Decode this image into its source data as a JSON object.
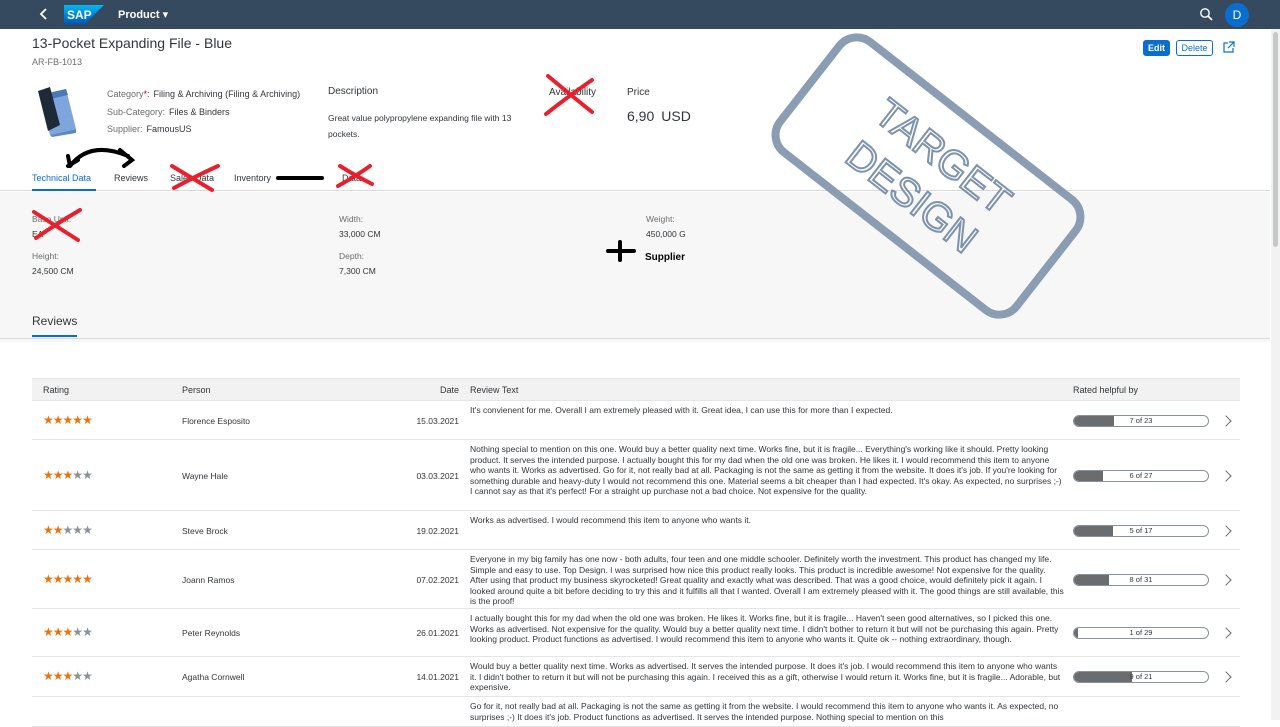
{
  "shell": {
    "app_title": "Product ▾",
    "avatar_initial": "D",
    "logo_text": "SAP"
  },
  "header": {
    "title": "13-Pocket Expanding File - Blue",
    "product_id": "AR-FB-1013",
    "edit_label": "Edit",
    "delete_label": "Delete",
    "category_label": "Category",
    "category_value": "Filing & Archiving (Filing & Archiving)",
    "subcategory_label": "Sub-Category:",
    "subcategory_value": "Files & Binders",
    "supplier_label": "Supplier:",
    "supplier_value": "FamousUS",
    "description_label": "Description",
    "description_text": "Great value polypropylene expanding file with 13 pockets.",
    "availability_label": "Availability",
    "price_label": "Price",
    "price_value": "6,90",
    "price_currency": "USD"
  },
  "tabs": [
    {
      "label": "Technical Data",
      "active": true
    },
    {
      "label": "Reviews"
    },
    {
      "label": "Sales Data"
    },
    {
      "label": "Inventory"
    },
    {
      "label": "Data"
    }
  ],
  "technical_data": {
    "base_unit_label": "Base Unit:",
    "base_unit_value": "EA",
    "width_label": "Width:",
    "width_value": "33,000 CM",
    "weight_label": "Weight:",
    "weight_value": "450,000 G",
    "height_label": "Height:",
    "height_value": "24,500 CM",
    "depth_label": "Depth:",
    "depth_value": "7,300 CM"
  },
  "annotations": {
    "plus_supplier": "Supplier",
    "stamp_line1": "TARGET",
    "stamp_line2": "DESIGN"
  },
  "reviews": {
    "section_title": "Reviews",
    "columns": [
      "Rating",
      "Person",
      "Date",
      "Review Text",
      "Rated helpful by"
    ],
    "rows": [
      {
        "rating": 5,
        "person": "Florence Esposito",
        "date": "15.03.2021",
        "text": "It's convienent for me. Overall I am extremely pleased with it. Great idea, I can use this for more than I expected.",
        "helpful": "7 of 23",
        "helpful_fraction": 0.3
      },
      {
        "rating": 3,
        "person": "Wayne Hale",
        "date": "03.03.2021",
        "text": "Nothing special to mention on this one. Would buy a better quality next time. Works fine, but it is fragile... Everything's working like it should. Pretty looking product. It serves the intended purpose. I actually bought this for my dad when the old one was broken. He likes it. I would recommend this item to anyone who wants it. Works as advertised. Go for it, not really bad at all. Packaging is not the same as getting it from the website. It does it's job. If you're looking for something durable and heavy-duty I would not recommend this one. Material seems a bit cheaper than I had expected. It's okay. As expected, no surprises ;-) I cannot say as that it's perfect! For a straight up purchase not a bad choice. Not expensive for the quality.",
        "helpful": "6 of 27",
        "helpful_fraction": 0.22
      },
      {
        "rating": 2,
        "person": "Steve Brock",
        "date": "19.02.2021",
        "text": "Works as advertised. I would recommend this item to anyone who wants it.",
        "helpful": "5 of 17",
        "helpful_fraction": 0.29
      },
      {
        "rating": 5,
        "person": "Joann Ramos",
        "date": "07.02.2021",
        "text": "Everyone in my big family has one now - both adults, four teen and one middle schooler. Definitely worth the investment. This product has changed my life. Simple and easy to use. Top Design. I was surprised how nice this product really looks. This product is incredible awesome! Not expensive for the quality. After using that product my business skyrocketed! Great quality and exactly what was described. That was a good choice, would definitely pick it again. I looked around quite a bit before deciding to try this and it fulfills all that I wanted. Overall I am extremely pleased with it. The good things are still available, this is the proof!",
        "helpful": "8 of 31",
        "helpful_fraction": 0.26
      },
      {
        "rating": 3,
        "person": "Peter Reynolds",
        "date": "26.01.2021",
        "text": "I actually bought this for my dad when the old one was broken. He likes it. Works fine, but it is fragile... Haven't seen good alternatives, so I picked this one. Works as advertised. Not expensive for the quality. Would buy a better quality next time. I didn't bother to return it but will not be purchasing this again. Pretty looking product. Product functions as advertised. I would recommend this item to anyone who wants it. Quite ok -- nothing extraordinary, though.",
        "helpful": "1 of 29",
        "helpful_fraction": 0.03
      },
      {
        "rating": 3,
        "person": "Agatha Cornwell",
        "date": "14.01.2021",
        "text": "Would buy a better quality next time. Works as advertised. It serves the intended purpose. It does it's job. I would recommend this item to anyone who wants it. I didn't bother to return it but will not be purchasing this again. I received this as a gift, otherwise I would return it. Works fine, but it is fragile... Adorable, but expensive.",
        "helpful": "9 of 21",
        "helpful_fraction": 0.43
      },
      {
        "rating": 0,
        "person": "",
        "date": "",
        "text": "Go for it, not really bad at all. Packaging is not the same as getting it from the website. I would recommend this item to anyone who wants it. As expected, no surprises ;-) It does it's job. Product functions as advertised. It serves the intended purpose. Nothing special to mention on this",
        "helpful": "",
        "helpful_fraction": 0
      }
    ]
  }
}
